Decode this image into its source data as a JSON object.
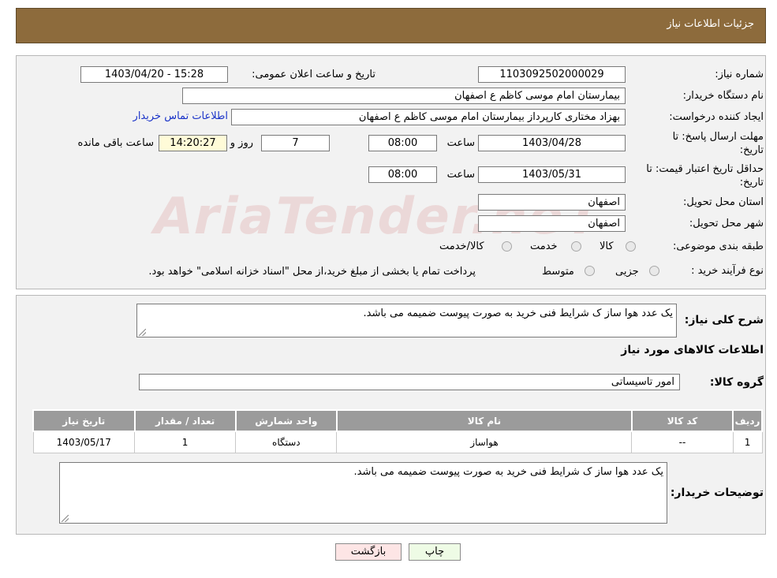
{
  "header": {
    "title": "جزئیات اطلاعات نیاز"
  },
  "form": {
    "need_number_label": "شماره نیاز:",
    "need_number_value": "1103092502000029",
    "announce_label": "تاریخ و ساعت اعلان عمومی:",
    "announce_value": "1403/04/20 - 15:28",
    "buyer_org_label": "نام دستگاه خریدار:",
    "buyer_org_value": "بیمارستان امام موسی کاظم ع  اصفهان",
    "requester_label": "ایجاد کننده درخواست:",
    "requester_value": "بهزاد مختاری کارپرداز بیمارستان امام موسی کاظم ع  اصفهان",
    "contact_link": "اطلاعات تماس خریدار",
    "deadline_label_1": "مهلت ارسال پاسخ: تا",
    "deadline_label_2": "تاریخ:",
    "deadline_date": "1403/04/28",
    "time_label": "ساعت",
    "deadline_time": "08:00",
    "days_value": "7",
    "days_label": "روز و",
    "remaining_time": "14:20:27",
    "remaining_label": "ساعت باقی مانده",
    "validity_label_1": "حداقل تاریخ اعتبار قیمت: تا",
    "validity_label_2": "تاریخ:",
    "validity_date": "1403/05/31",
    "validity_time": "08:00",
    "province_label": "استان محل تحویل:",
    "province_value": "اصفهان",
    "city_label": "شهر محل تحویل:",
    "city_value": "اصفهان",
    "category_label": "طبقه بندی موضوعی:",
    "category_options": [
      "کالا",
      "خدمت",
      "کالا/خدمت"
    ],
    "process_label": "نوع فرآیند خرید :",
    "process_options": [
      "جزیی",
      "متوسط"
    ],
    "process_note": "پرداخت تمام یا بخشی از مبلغ خرید،از محل \"اسناد خزانه اسلامی\" خواهد بود."
  },
  "watermark": "AriaTender.neT",
  "details": {
    "summary_label": "شرح کلی نیاز:",
    "summary_value": "یک عدد هوا ساز ک شرایط فنی  خرید به صورت پیوست ضمیمه می باشد.",
    "goods_info_title": "اطلاعات کالاهای مورد نیاز",
    "goods_group_label": "گروه کالا:",
    "goods_group_value": "امور تاسیساتی",
    "table_headers": [
      "ردیف",
      "کد کالا",
      "نام کالا",
      "واحد شمارش",
      "تعداد / مقدار",
      "تاریخ نیاز"
    ],
    "table_rows": [
      [
        "1",
        "--",
        "هواساز",
        "دستگاه",
        "1",
        "1403/05/17"
      ]
    ],
    "buyer_notes_label": "توضیحات خریدار:",
    "buyer_notes_value": "یک عدد هوا ساز ک شرایط فنی  خرید به صورت پیوست ضمیمه می باشد."
  },
  "buttons": {
    "print": "چاپ",
    "back": "بازگشت"
  }
}
